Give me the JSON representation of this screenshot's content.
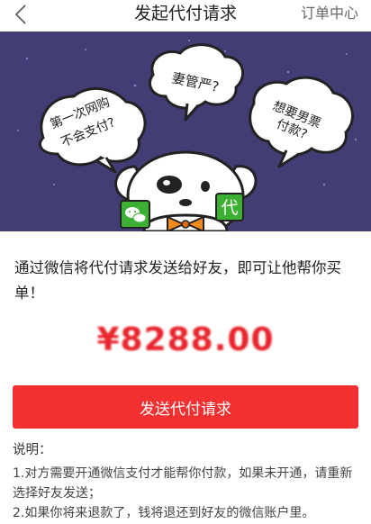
{
  "nav": {
    "title": "发起代付请求",
    "right_link": "订单中心"
  },
  "banner": {
    "bubble_left": [
      "第一次网购",
      "不会支付?"
    ],
    "bubble_middle": "妻管严?",
    "bubble_right": [
      "想要男票",
      "付款?"
    ],
    "badge_text": "代",
    "background_color": "#423d75"
  },
  "description": "通过微信将代付请求发送给好友，即可让他帮你买单！",
  "amount": "¥8288.00",
  "send_button": "发送代付请求",
  "notes": {
    "title": "说明：",
    "items": [
      "1.对方需要开通微信支付才能帮你付款，如果未开通，请重新选择好友发送；",
      "2.如果你将来退款了，钱将退还到好友的微信账户里。"
    ]
  },
  "colors": {
    "accent": "#f23030",
    "amount": "#e8242c",
    "wechat_green": "#3cb034"
  }
}
